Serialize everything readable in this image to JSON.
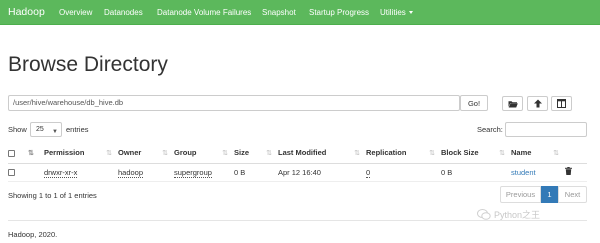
{
  "navbar": {
    "brand": "Hadoop",
    "items": [
      "Overview",
      "Datanodes",
      "Datanode Volume Failures",
      "Snapshot",
      "Startup Progress",
      "Utilities"
    ],
    "accent_color": "#5cb85c"
  },
  "page_title": "Browse Directory",
  "path_bar": {
    "value": "/user/hive/warehouse/db_hive.db",
    "go_label": "Go!",
    "icons": [
      "folder-open-icon",
      "upload-icon",
      "column-icon"
    ]
  },
  "table_controls": {
    "show_label": "Show",
    "entries_value": "25",
    "entries_label": "entries",
    "search_label": "Search:"
  },
  "table": {
    "columns": [
      "Permission",
      "Owner",
      "Group",
      "Size",
      "Last Modified",
      "Replication",
      "Block Size",
      "Name"
    ],
    "rows": [
      {
        "permission": "drwxr-xr-x",
        "owner": "hadoop",
        "group": "supergroup",
        "size": "0 B",
        "last_modified": "Apr 12 16:40",
        "replication": "0",
        "block_size": "0 B",
        "name": "student"
      }
    ]
  },
  "info_text": "Showing 1 to 1 of 1 entries",
  "pagination": {
    "previous": "Previous",
    "current": "1",
    "next": "Next"
  },
  "footer": "Hadoop, 2020.",
  "watermark": "Python之王"
}
